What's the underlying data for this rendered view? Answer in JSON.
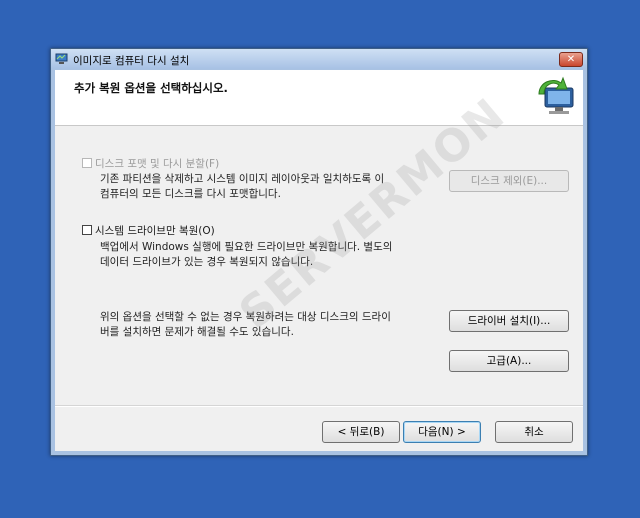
{
  "window": {
    "title": "이미지로 컴퓨터 다시 설치",
    "close_label": "✕"
  },
  "header": {
    "title": "추가 복원 옵션을 선택하십시오."
  },
  "options": {
    "format": {
      "label": "디스크 포맷 및 다시 분할(F)",
      "checked": false,
      "enabled": false,
      "desc_line1": "기존 파티션을 삭제하고 시스템 이미지 레이아웃과 일치하도록 이",
      "desc_line2": "컴퓨터의 모든 디스크를 다시 포맷합니다.",
      "button_label": "디스크 제외(E)..."
    },
    "system_only": {
      "label": "시스템 드라이브만 복원(O)",
      "checked": false,
      "enabled": true,
      "desc_line1": "백업에서 Windows 실행에 필요한 드라이브만 복원합니다. 별도의",
      "desc_line2": "데이터 드라이브가 있는 경우 복원되지 않습니다."
    },
    "driver": {
      "desc_line1": "위의 옵션을 선택할 수 없는 경우 복원하려는 대상 디스크의 드라이",
      "desc_line2": "버를 설치하면 문제가 해결될 수도 있습니다.",
      "install_label": "드라이버 설치(I)...",
      "advanced_label": "고급(A)..."
    }
  },
  "footer": {
    "back_label": "< 뒤로(B)",
    "next_label": "다음(N) >",
    "cancel_label": "취소"
  },
  "watermark": "SERVERMON",
  "colors": {
    "desktop": "#2f63b7",
    "accent": "#3c7fb1"
  }
}
